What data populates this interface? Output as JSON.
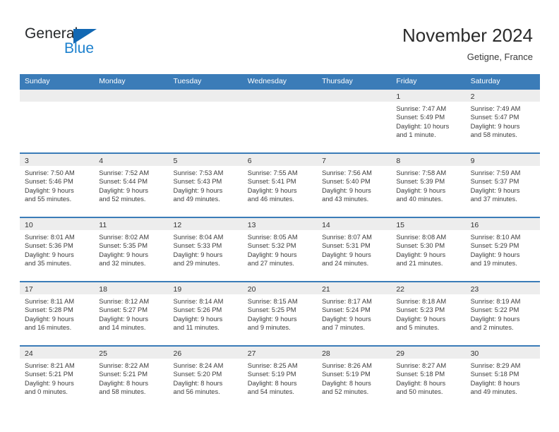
{
  "brand": {
    "word_one": "General",
    "word_two": "Blue",
    "triangle_icon": "triangle-icon",
    "accent_dark": "#26292b",
    "accent_blue": "#1d81ce",
    "triangle_blue": "#1268b3"
  },
  "header": {
    "title": "November 2024",
    "subtitle": "Getigne, France"
  },
  "theme": {
    "header_bar": "#3b7cb8",
    "daynum_band": "#ededed",
    "text": "#3c3c3c"
  },
  "weekdays": [
    "Sunday",
    "Monday",
    "Tuesday",
    "Wednesday",
    "Thursday",
    "Friday",
    "Saturday"
  ],
  "weeks": [
    [
      {
        "day": "",
        "lines": []
      },
      {
        "day": "",
        "lines": []
      },
      {
        "day": "",
        "lines": []
      },
      {
        "day": "",
        "lines": []
      },
      {
        "day": "",
        "lines": []
      },
      {
        "day": "1",
        "lines": [
          "Sunrise: 7:47 AM",
          "Sunset: 5:49 PM",
          "Daylight: 10 hours",
          "and 1 minute."
        ]
      },
      {
        "day": "2",
        "lines": [
          "Sunrise: 7:49 AM",
          "Sunset: 5:47 PM",
          "Daylight: 9 hours",
          "and 58 minutes."
        ]
      }
    ],
    [
      {
        "day": "3",
        "lines": [
          "Sunrise: 7:50 AM",
          "Sunset: 5:46 PM",
          "Daylight: 9 hours",
          "and 55 minutes."
        ]
      },
      {
        "day": "4",
        "lines": [
          "Sunrise: 7:52 AM",
          "Sunset: 5:44 PM",
          "Daylight: 9 hours",
          "and 52 minutes."
        ]
      },
      {
        "day": "5",
        "lines": [
          "Sunrise: 7:53 AM",
          "Sunset: 5:43 PM",
          "Daylight: 9 hours",
          "and 49 minutes."
        ]
      },
      {
        "day": "6",
        "lines": [
          "Sunrise: 7:55 AM",
          "Sunset: 5:41 PM",
          "Daylight: 9 hours",
          "and 46 minutes."
        ]
      },
      {
        "day": "7",
        "lines": [
          "Sunrise: 7:56 AM",
          "Sunset: 5:40 PM",
          "Daylight: 9 hours",
          "and 43 minutes."
        ]
      },
      {
        "day": "8",
        "lines": [
          "Sunrise: 7:58 AM",
          "Sunset: 5:39 PM",
          "Daylight: 9 hours",
          "and 40 minutes."
        ]
      },
      {
        "day": "9",
        "lines": [
          "Sunrise: 7:59 AM",
          "Sunset: 5:37 PM",
          "Daylight: 9 hours",
          "and 37 minutes."
        ]
      }
    ],
    [
      {
        "day": "10",
        "lines": [
          "Sunrise: 8:01 AM",
          "Sunset: 5:36 PM",
          "Daylight: 9 hours",
          "and 35 minutes."
        ]
      },
      {
        "day": "11",
        "lines": [
          "Sunrise: 8:02 AM",
          "Sunset: 5:35 PM",
          "Daylight: 9 hours",
          "and 32 minutes."
        ]
      },
      {
        "day": "12",
        "lines": [
          "Sunrise: 8:04 AM",
          "Sunset: 5:33 PM",
          "Daylight: 9 hours",
          "and 29 minutes."
        ]
      },
      {
        "day": "13",
        "lines": [
          "Sunrise: 8:05 AM",
          "Sunset: 5:32 PM",
          "Daylight: 9 hours",
          "and 27 minutes."
        ]
      },
      {
        "day": "14",
        "lines": [
          "Sunrise: 8:07 AM",
          "Sunset: 5:31 PM",
          "Daylight: 9 hours",
          "and 24 minutes."
        ]
      },
      {
        "day": "15",
        "lines": [
          "Sunrise: 8:08 AM",
          "Sunset: 5:30 PM",
          "Daylight: 9 hours",
          "and 21 minutes."
        ]
      },
      {
        "day": "16",
        "lines": [
          "Sunrise: 8:10 AM",
          "Sunset: 5:29 PM",
          "Daylight: 9 hours",
          "and 19 minutes."
        ]
      }
    ],
    [
      {
        "day": "17",
        "lines": [
          "Sunrise: 8:11 AM",
          "Sunset: 5:28 PM",
          "Daylight: 9 hours",
          "and 16 minutes."
        ]
      },
      {
        "day": "18",
        "lines": [
          "Sunrise: 8:12 AM",
          "Sunset: 5:27 PM",
          "Daylight: 9 hours",
          "and 14 minutes."
        ]
      },
      {
        "day": "19",
        "lines": [
          "Sunrise: 8:14 AM",
          "Sunset: 5:26 PM",
          "Daylight: 9 hours",
          "and 11 minutes."
        ]
      },
      {
        "day": "20",
        "lines": [
          "Sunrise: 8:15 AM",
          "Sunset: 5:25 PM",
          "Daylight: 9 hours",
          "and 9 minutes."
        ]
      },
      {
        "day": "21",
        "lines": [
          "Sunrise: 8:17 AM",
          "Sunset: 5:24 PM",
          "Daylight: 9 hours",
          "and 7 minutes."
        ]
      },
      {
        "day": "22",
        "lines": [
          "Sunrise: 8:18 AM",
          "Sunset: 5:23 PM",
          "Daylight: 9 hours",
          "and 5 minutes."
        ]
      },
      {
        "day": "23",
        "lines": [
          "Sunrise: 8:19 AM",
          "Sunset: 5:22 PM",
          "Daylight: 9 hours",
          "and 2 minutes."
        ]
      }
    ],
    [
      {
        "day": "24",
        "lines": [
          "Sunrise: 8:21 AM",
          "Sunset: 5:21 PM",
          "Daylight: 9 hours",
          "and 0 minutes."
        ]
      },
      {
        "day": "25",
        "lines": [
          "Sunrise: 8:22 AM",
          "Sunset: 5:21 PM",
          "Daylight: 8 hours",
          "and 58 minutes."
        ]
      },
      {
        "day": "26",
        "lines": [
          "Sunrise: 8:24 AM",
          "Sunset: 5:20 PM",
          "Daylight: 8 hours",
          "and 56 minutes."
        ]
      },
      {
        "day": "27",
        "lines": [
          "Sunrise: 8:25 AM",
          "Sunset: 5:19 PM",
          "Daylight: 8 hours",
          "and 54 minutes."
        ]
      },
      {
        "day": "28",
        "lines": [
          "Sunrise: 8:26 AM",
          "Sunset: 5:19 PM",
          "Daylight: 8 hours",
          "and 52 minutes."
        ]
      },
      {
        "day": "29",
        "lines": [
          "Sunrise: 8:27 AM",
          "Sunset: 5:18 PM",
          "Daylight: 8 hours",
          "and 50 minutes."
        ]
      },
      {
        "day": "30",
        "lines": [
          "Sunrise: 8:29 AM",
          "Sunset: 5:18 PM",
          "Daylight: 8 hours",
          "and 49 minutes."
        ]
      }
    ]
  ]
}
